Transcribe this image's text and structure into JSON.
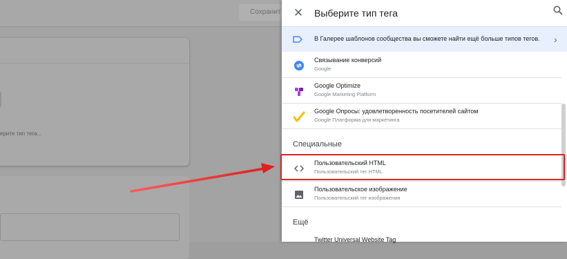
{
  "background": {
    "save_label": "Сохранит",
    "card_text": "ерите тип тега..."
  },
  "panel": {
    "title": "Выберите тип тега",
    "gallery_text": "В Галерее шаблонов сообщества вы сможете найти ещё больше типов тегов.",
    "items": [
      {
        "title": "Связывание конверсий",
        "subtitle": "Google"
      },
      {
        "title": "Google Optimize",
        "subtitle": "Google Marketing Platform"
      },
      {
        "title": "Google Опросы: удовлетворенность посетителей сайтом",
        "subtitle": "Google Платформа для маркетинга"
      }
    ],
    "section_special": "Специальные",
    "special_items": [
      {
        "title": "Пользовательский HTML",
        "subtitle": "Пользовательский тег HTML"
      },
      {
        "title": "Пользовательское изображение",
        "subtitle": "Пользовательский тег изображения"
      }
    ],
    "section_more": "Ещё",
    "more_items": [
      {
        "title": "Twitter Universal Website Tag"
      }
    ]
  },
  "colors": {
    "highlight": "#e0201f",
    "accent_blue": "#4285f4",
    "optimize_purple": "#a142f4",
    "surveys_yellow": "#fbbc04"
  },
  "icons": [
    "close-icon",
    "search-icon",
    "tag-icon",
    "chevron-right-icon",
    "conversion-linker-icon",
    "google-optimize-icon",
    "google-surveys-icon",
    "code-brackets-icon",
    "image-icon"
  ]
}
